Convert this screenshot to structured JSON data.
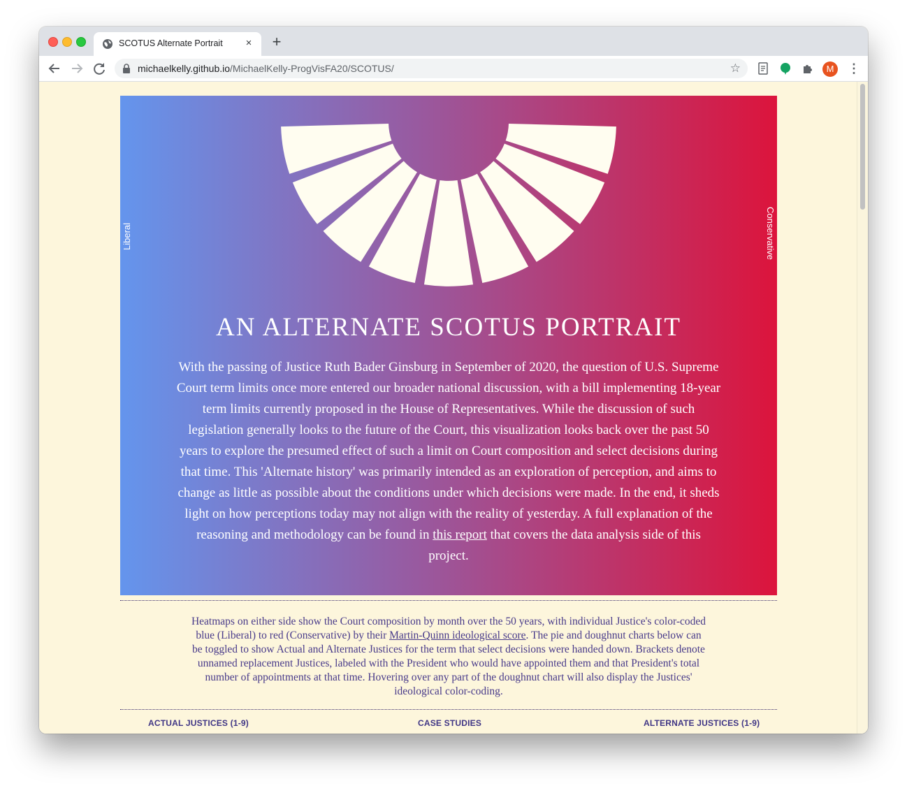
{
  "browser": {
    "tab_title": "SCOTUS Alternate Portrait",
    "tab_close": "×",
    "new_tab": "+",
    "url_host": "michaelkelly.github.io",
    "url_path": "/MichaelKelly-ProgVisFA20/SCOTUS/",
    "avatar_letter": "M",
    "icons": [
      "back-icon",
      "forward-icon",
      "reload-icon",
      "lock-icon",
      "star-icon",
      "page-icon",
      "grammarly-icon",
      "puzzle-icon",
      "kebab-menu-icon"
    ]
  },
  "hero": {
    "left_label": "Liberal",
    "right_label": "Conservative",
    "title": "AN ALTERNATE SCOTUS PORTRAIT",
    "intro_before": "With the passing of Justice Ruth Bader Ginsburg in September of 2020, the question of U.S. Supreme Court term limits once more entered our broader national discussion, with a bill implementing 18-year term limits currently proposed in the House of Representatives. While the discussion of such legislation generally looks to the future of the Court, this visualization looks back over the past 50 years to explore the presumed effect of such a limit on Court composition and select decisions during that time. This 'Alternate history' was primarily intended as an exploration of perception, and aims to change as little as possible about the conditions under which decisions were made. In the end, it sheds light on how perceptions today may not align with the reality of yesterday. A full explanation of the reasoning and methodology can be found in ",
    "intro_link": "this report",
    "intro_after": " that covers the data analysis side of this project.",
    "gradient": [
      "#6495ed",
      "#985aa0",
      "#dc143c"
    ],
    "seat_color": "#fffdf0"
  },
  "description": {
    "before": "Heatmaps on either side show the Court composition by month over the 50 years, with individual Justice's color-coded blue (Liberal) to red (Conservative) by their ",
    "link": "Martin-Quinn ideological score",
    "after": ". The pie and doughnut charts below can be toggled to show Actual and Alternate Justices for the term that select decisions were handed down. Brackets denote unnamed replacement Justices, labeled with the President who would have appointed them and that President's total number of appointments at that time. Hovering over any part of the doughnut chart will also display the Justices' ideological color-coding."
  },
  "columns": {
    "left": "ACTUAL JUSTICES (1-9)",
    "center": "CASE STUDIES",
    "right": "ALTERNATE JUSTICES (1-9)"
  },
  "theme": {
    "page_bg": "#fdf6dc",
    "text_color": "#483a8a"
  }
}
